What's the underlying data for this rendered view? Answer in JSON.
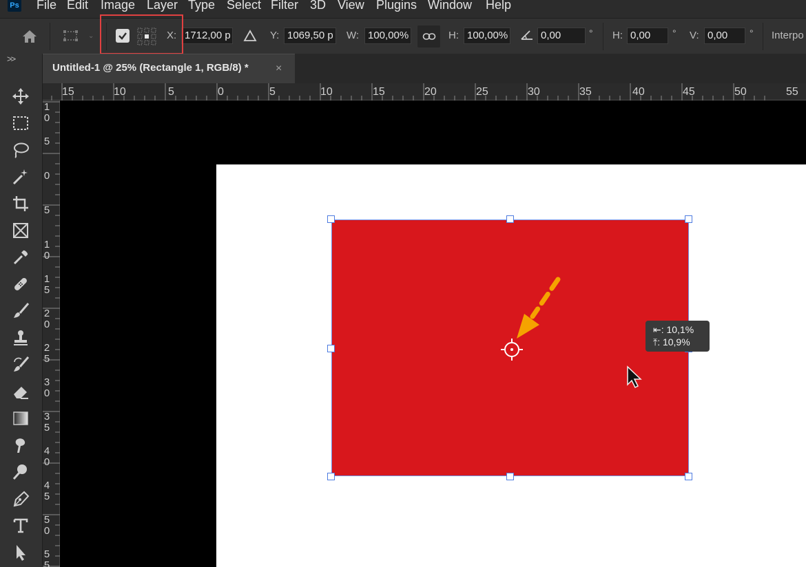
{
  "app": {
    "logo_text": "Ps"
  },
  "menu": [
    "File",
    "Edit",
    "Image",
    "Layer",
    "Type",
    "Select",
    "Filter",
    "3D",
    "View",
    "Plugins",
    "Window",
    "Help"
  ],
  "options": {
    "x_label": "X:",
    "x_value": "1712,00 p",
    "y_label": "Y:",
    "y_value": "1069,50 p",
    "w_label": "W:",
    "w_value": "100,00%",
    "h_label": "H:",
    "h_value": "100,00%",
    "angle_value": "0,00",
    "angle_unit": "°",
    "skew_h_label": "H:",
    "skew_h_value": "0,00",
    "skew_h_unit": "°",
    "skew_v_label": "V:",
    "skew_v_value": "0,00",
    "skew_v_unit": "°",
    "interpolation_label": "Interpo"
  },
  "tab": {
    "title": "Untitled-1 @ 25% (Rectangle 1, RGB/8) *",
    "close": "×"
  },
  "toolbar": {
    "collapse": ">>"
  },
  "tools": [
    "move-tool",
    "marquee-tool",
    "lasso-tool",
    "magic-wand-tool",
    "crop-tool",
    "frame-tool",
    "eyedropper-tool",
    "healing-brush-tool",
    "brush-tool",
    "clone-stamp-tool",
    "history-brush-tool",
    "eraser-tool",
    "gradient-tool",
    "smudge-tool",
    "dodge-tool",
    "pen-tool",
    "type-tool",
    "path-selection-tool"
  ],
  "ruler_h": [
    "15",
    "10",
    "5",
    "0",
    "5",
    "10",
    "15",
    "20",
    "25",
    "30",
    "35",
    "40",
    "45",
    "50",
    "55"
  ],
  "ruler_v": [
    "1 0",
    "5",
    "0",
    "5",
    "1 0",
    "1 5",
    "2 0",
    "2 5",
    "3 0",
    "3 5",
    "4 0",
    "4 5",
    "5 0",
    "5 5"
  ],
  "tooltip": {
    "line1": "⇤: 10,1%",
    "line2": "⤒: 10,9%"
  },
  "colors": {
    "accent_red": "#d8171c",
    "highlight_box": "#e04040",
    "arrow": "#f5a300",
    "handle_border": "#4d7be0"
  }
}
